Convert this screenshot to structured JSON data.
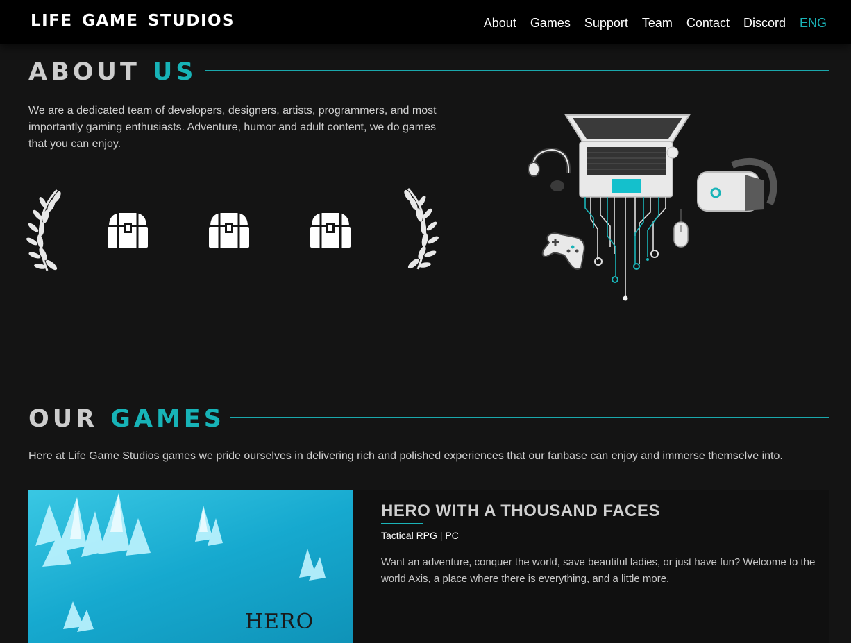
{
  "header": {
    "logo": "LIFE GAME STUDIOS",
    "nav": [
      {
        "label": "About"
      },
      {
        "label": "Games"
      },
      {
        "label": "Support"
      },
      {
        "label": "Team"
      },
      {
        "label": "Contact"
      },
      {
        "label": "Discord"
      },
      {
        "label": "ENG",
        "active": true
      }
    ]
  },
  "about": {
    "title_plain": "ABOUT",
    "title_accent": "US",
    "text": "We are a dedicated team of developers, designers, artists, programmers, and most importantly gaming enthusiasts. Adventure, humor and adult content, we do games that you can enjoy.",
    "illustration_icons": [
      "laptop-icon",
      "headset-icon",
      "vr-headset-icon",
      "gamepad-icon",
      "mouse-icon",
      "circuit-lines"
    ]
  },
  "games": {
    "title_plain": "OUR",
    "title_accent": "GAMES",
    "intro": "Here at Life Game Studios games we pride ourselves in delivering rich and polished experiences that our fanbase can enjoy and immerse themselve into.",
    "items": [
      {
        "title": "HERO WITH A THOUSAND FACES",
        "meta": "Tactical RPG | PC",
        "description": "Want an adventure, conquer the world, save beautiful ladies, or just have fun? Welcome to the world Axis, a place where there is everything, and a little more.",
        "image_logo_text": "HERO"
      }
    ]
  },
  "colors": {
    "accent": "#1ab4b8",
    "background": "#141414",
    "header": "#000000"
  }
}
